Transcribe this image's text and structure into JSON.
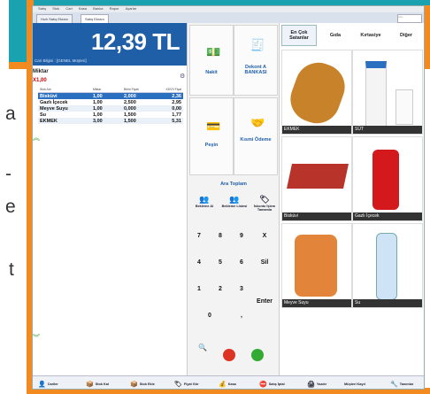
{
  "background_text": [
    "a",
    "-",
    "e",
    "t"
  ],
  "menu": [
    "Satış",
    "Stok",
    "Cari",
    "Kasa",
    "Banka",
    "Rapor",
    "Ayarlar"
  ],
  "tabs": [
    "Hızlı Satış Ekranı",
    "Satış Ekranı"
  ],
  "search_placeholder": "Ara...",
  "total_amount": "12,39 TL",
  "cari_label": "Cari Bilgisi : [GENEL Müşteri]",
  "miktar_label": "Miktar",
  "miktar_value": "X1,00",
  "columns": [
    "Stok Adı",
    "Miktar",
    "Birim Fiyatı",
    "KDV'li Fiyat"
  ],
  "items": [
    {
      "name": "Bisküvi",
      "qty": "1,00",
      "price": "2,000",
      "total": "2,36"
    },
    {
      "name": "Gazlı İçecek",
      "qty": "1,00",
      "price": "2,500",
      "total": "2,95"
    },
    {
      "name": "Meyve Suyu",
      "qty": "1,00",
      "price": "0,000",
      "total": "0,00"
    },
    {
      "name": "Su",
      "qty": "1,00",
      "price": "1,500",
      "total": "1,77"
    },
    {
      "name": "EKMEK",
      "qty": "3,00",
      "price": "1,500",
      "total": "5,31"
    }
  ],
  "actions": {
    "nakit": "Nakit",
    "dekont": "Dekont A BANKASI",
    "pesin": "Peşin",
    "kismi": "Kısmi Ödeme",
    "ara_toplam": "Ara Toplam",
    "small": [
      "Bekleme Al",
      "Bekleme Listesi",
      "İskonto İşlem Tamamla"
    ],
    "enter": "Enter",
    "sil": "Sil"
  },
  "keypad": [
    "7",
    "8",
    "9",
    "X",
    "4",
    "5",
    "6",
    "Sil",
    "1",
    "2",
    "3",
    "0",
    ","
  ],
  "categories": [
    "En Çok Satanlar",
    "Gıda",
    "Kırtasiye",
    "Diğer"
  ],
  "products": [
    "EKMEK",
    "SÜT",
    "Bisküvi",
    "Gazlı İçecek",
    "Meyve Suyu",
    "Su"
  ],
  "bottom": [
    "Cariler",
    "Stok Kal",
    "Stok Ekle",
    "Fiyat Gör",
    "Kasa",
    "Satış İptal",
    "Yazdır",
    "Müşteri Kayıt",
    "Tanımlar"
  ]
}
